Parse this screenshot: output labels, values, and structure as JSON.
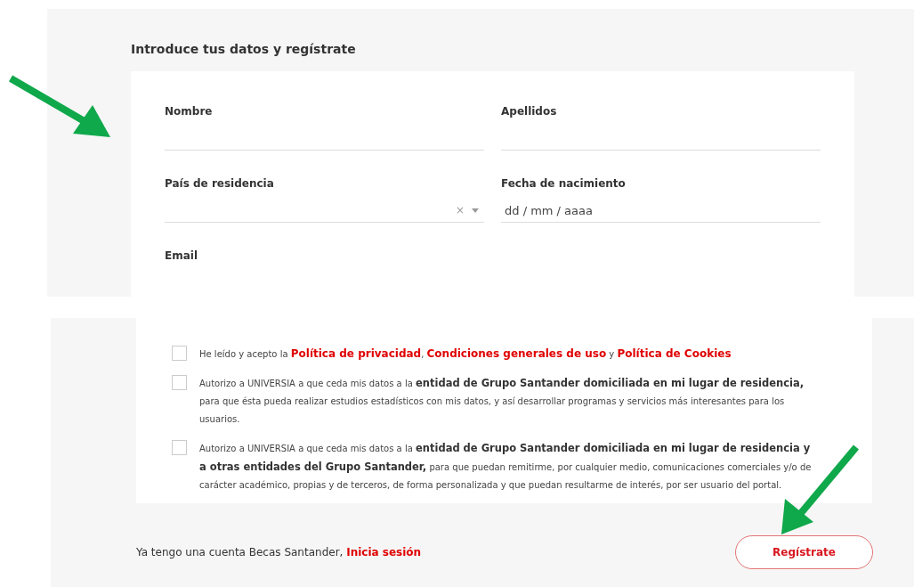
{
  "form_title": "Introduce tus datos y regístrate",
  "fields": [
    {
      "kind": "text",
      "label": "Nombre"
    },
    {
      "kind": "text",
      "label": "Apellidos"
    },
    {
      "kind": "select",
      "label": "País de residencia",
      "clear": "×"
    },
    {
      "kind": "date",
      "label": "Fecha de nacimiento",
      "placeholder": "dd / mm / aaaa"
    },
    {
      "kind": "cut",
      "label": "Email"
    }
  ],
  "consents": [
    {
      "checked": false,
      "parts": [
        {
          "kind": "text",
          "text": "He leído y acepto la "
        },
        {
          "kind": "link",
          "text": "Política de privacidad"
        },
        {
          "kind": "text",
          "text": ", "
        },
        {
          "kind": "link",
          "text": "Condiciones generales de uso"
        },
        {
          "kind": "text",
          "text": " y "
        },
        {
          "kind": "link",
          "text": "Política de Cookies"
        }
      ]
    },
    {
      "checked": false,
      "parts": [
        {
          "kind": "text",
          "text": "Autorizo a UNIVERSIA a que ceda mis datos a la **entidad de Grupo Santander domiciliada en mi lugar de residencia,** para que ésta pueda realizar estudios estadísticos con mis datos, y así desarrollar programas y servicios más interesantes para los usuarios."
        }
      ]
    },
    {
      "checked": false,
      "parts": [
        {
          "kind": "text",
          "text": "Autorizo a UNIVERSIA a que ceda mis datos a la **entidad de Grupo Santander domiciliada en mi lugar de residencia y a otras entidades del Grupo Santander,** para que puedan remitirme, por cualquier medio, comunicaciones comerciales y/o de carácter académico, propias y de terceros, de forma personalizada y que puedan resultarme de interés, por ser usuario del portal."
        }
      ]
    }
  ],
  "footer": {
    "text": "Ya tengo una cuenta Becas Santander, ",
    "link": "Inicia sesión",
    "button": "Regístrate"
  }
}
